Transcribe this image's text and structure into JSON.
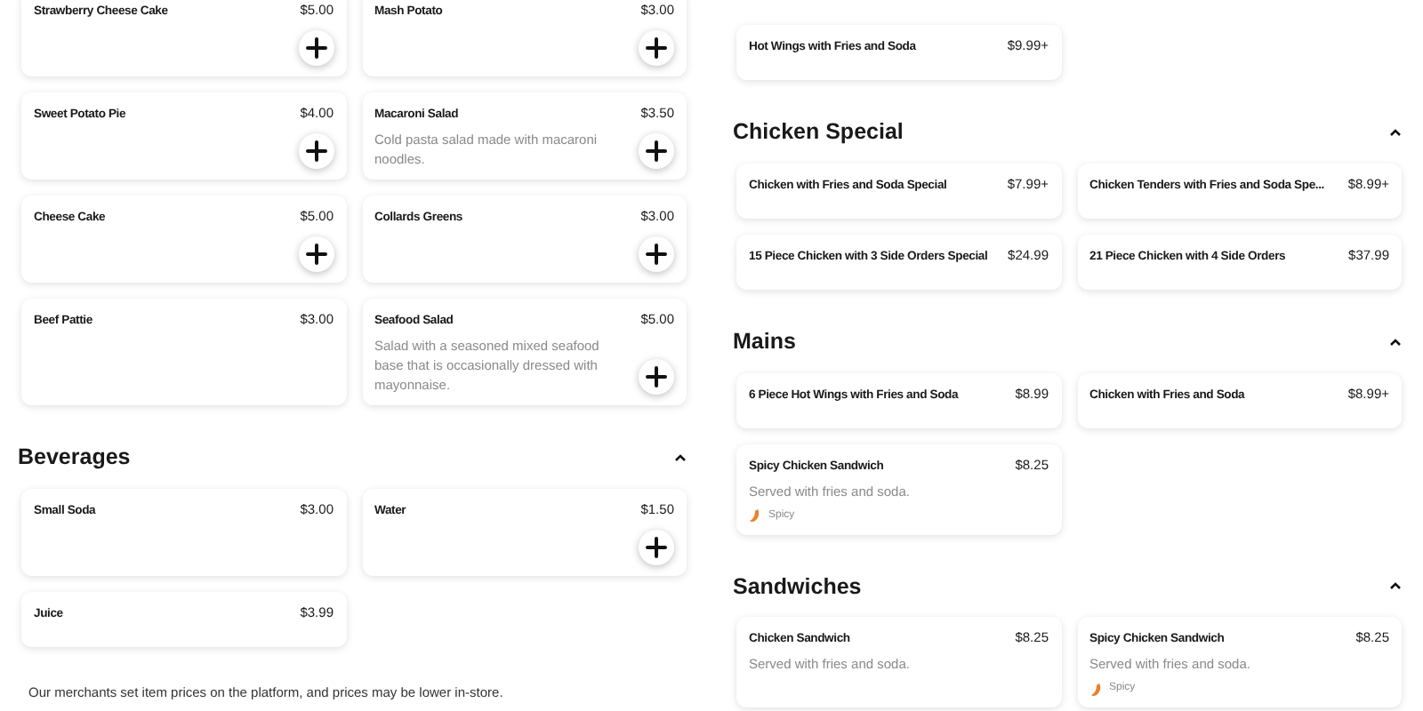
{
  "left_column": {
    "sections": [
      {
        "items": [
          {
            "name": "Strawberry Cheese Cake",
            "price": "$5.00",
            "add_button": true
          },
          {
            "name": "Mash Potato",
            "price": "$3.00",
            "add_button": true
          },
          {
            "name": "Sweet Potato Pie",
            "price": "$4.00",
            "add_button": true
          },
          {
            "name": "Macaroni Salad",
            "price": "$3.50",
            "description": "Cold pasta salad made with macaroni noodles.",
            "add_button": true
          },
          {
            "name": "Cheese Cake",
            "price": "$5.00",
            "add_button": true
          },
          {
            "name": "Collards Greens",
            "price": "$3.00",
            "add_button": true
          },
          {
            "name": "Beef Pattie",
            "price": "$3.00",
            "add_button": false
          },
          {
            "name": "Seafood Salad",
            "price": "$5.00",
            "description": "Salad with a seasoned mixed seafood base that is occasionally dressed with mayonnaise.",
            "add_button": true
          }
        ]
      },
      {
        "title": "Beverages",
        "expanded": true,
        "items": [
          {
            "name": "Small Soda",
            "price": "$3.00",
            "add_button": false
          },
          {
            "name": "Water",
            "price": "$1.50",
            "add_button": true
          },
          {
            "name": "Juice",
            "price": "$3.99",
            "add_button": false
          }
        ]
      }
    ],
    "footer": "Our merchants set item prices on the platform, and prices may be lower in-store."
  },
  "right_column": {
    "sections": [
      {
        "items": [
          {
            "name": "Hot Wings with Fries and Soda",
            "price": "$9.99+",
            "add_button": false
          }
        ]
      },
      {
        "title": "Chicken Special",
        "expanded": true,
        "items": [
          {
            "name": "Chicken with Fries and Soda Special",
            "price": "$7.99+",
            "add_button": false
          },
          {
            "name": "Chicken Tenders with Fries and Soda Spe...",
            "price": "$8.99+",
            "add_button": false
          },
          {
            "name": "15 Piece Chicken with 3 Side Orders Special",
            "price": "$24.99",
            "add_button": false
          },
          {
            "name": "21 Piece Chicken with 4 Side Orders",
            "price": "$37.99",
            "add_button": false
          }
        ]
      },
      {
        "title": "Mains",
        "expanded": true,
        "items": [
          {
            "name": "6 Piece Hot Wings with Fries and Soda",
            "price": "$8.99",
            "add_button": false
          },
          {
            "name": "Chicken with Fries and Soda",
            "price": "$8.99+",
            "add_button": false
          },
          {
            "name": "Spicy Chicken Sandwich",
            "price": "$8.25",
            "description": "Served with fries and soda.",
            "tags": [
              "Spicy"
            ],
            "add_button": false
          }
        ]
      },
      {
        "title": "Sandwiches",
        "expanded": true,
        "items": [
          {
            "name": "Chicken Sandwich",
            "price": "$8.25",
            "description": "Served with fries and soda.",
            "add_button": false
          },
          {
            "name": "Spicy Chicken Sandwich",
            "price": "$8.25",
            "description": "Served with fries and soda.",
            "tags": [
              "Spicy"
            ],
            "add_button": false
          }
        ]
      }
    ]
  }
}
